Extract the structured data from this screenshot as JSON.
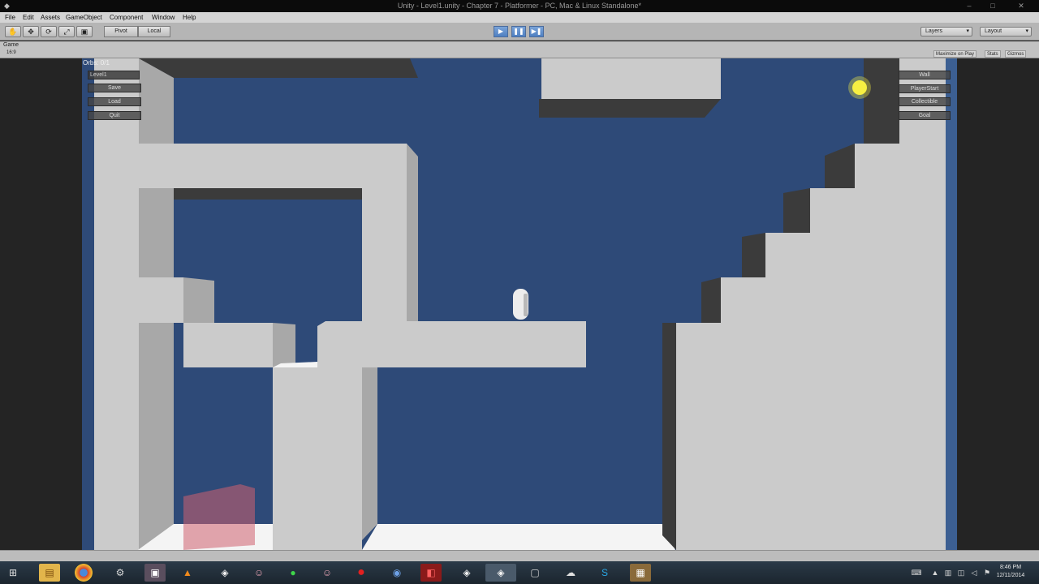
{
  "window": {
    "title": "Unity - Level1.unity - Chapter 7 - Platformer - PC, Mac & Linux Standalone*",
    "minimize": "–",
    "maximize": "□",
    "close": "✕"
  },
  "menu": {
    "items": [
      {
        "label": "File"
      },
      {
        "label": "Edit"
      },
      {
        "label": "Assets"
      },
      {
        "label": "GameObject"
      },
      {
        "label": "Component"
      },
      {
        "label": "Window"
      },
      {
        "label": "Help"
      }
    ]
  },
  "toolbar": {
    "pivot_label": "Pivot",
    "local_label": "Local",
    "layers_label": "Layers",
    "layout_label": "Layout",
    "play_glyph": "▶",
    "pause_glyph": "❚❚",
    "step_glyph": "▶❚",
    "hand_glyph": "✋",
    "move_glyph": "✥",
    "rotate_glyph": "⟳",
    "scale_glyph": "⤢",
    "rect_glyph": "▣",
    "caret": "▾"
  },
  "game_tab": {
    "label": "Game",
    "aspect": "16:9",
    "maximize_on_play": "Maximize on Play",
    "stats": "Stats",
    "gizmos": "Gizmos"
  },
  "gui": {
    "orbs_label": "Orbs: 0/1",
    "level_field": "Level1",
    "left_buttons": [
      "Save",
      "Load",
      "Quit"
    ],
    "right_buttons": [
      "Wall",
      "PlayerStart",
      "Collectible",
      "Goal"
    ]
  },
  "scene": {
    "background": "#2e4a78",
    "wall_light": "#cbcbcb",
    "wall_mid": "#a8a8a8",
    "wall_shadow": "#3b3b3b",
    "floor_white": "#f4f4f4",
    "orb_color": "#f7f042",
    "cube_color": "#d06070"
  },
  "taskbar": {
    "clock_time": "8:46 PM",
    "clock_date": "12/11/2014",
    "icons": [
      "start-icon",
      "explorer-icon",
      "chrome-icon",
      "steam-icon",
      "monitor-app-icon",
      "vlc-icon",
      "unity-icon",
      "character-app-icon",
      "android-icon",
      "character-app2-icon",
      "record-icon",
      "unreal-icon",
      "app-red-icon",
      "unity2-icon",
      "unity3-icon",
      "window-app-icon",
      "cloud-app-icon",
      "skype-icon",
      "photo-app-icon"
    ],
    "tray": [
      "keyboard-icon",
      "flag-icon",
      "network-icon",
      "volume-icon",
      "notification-icon"
    ]
  }
}
